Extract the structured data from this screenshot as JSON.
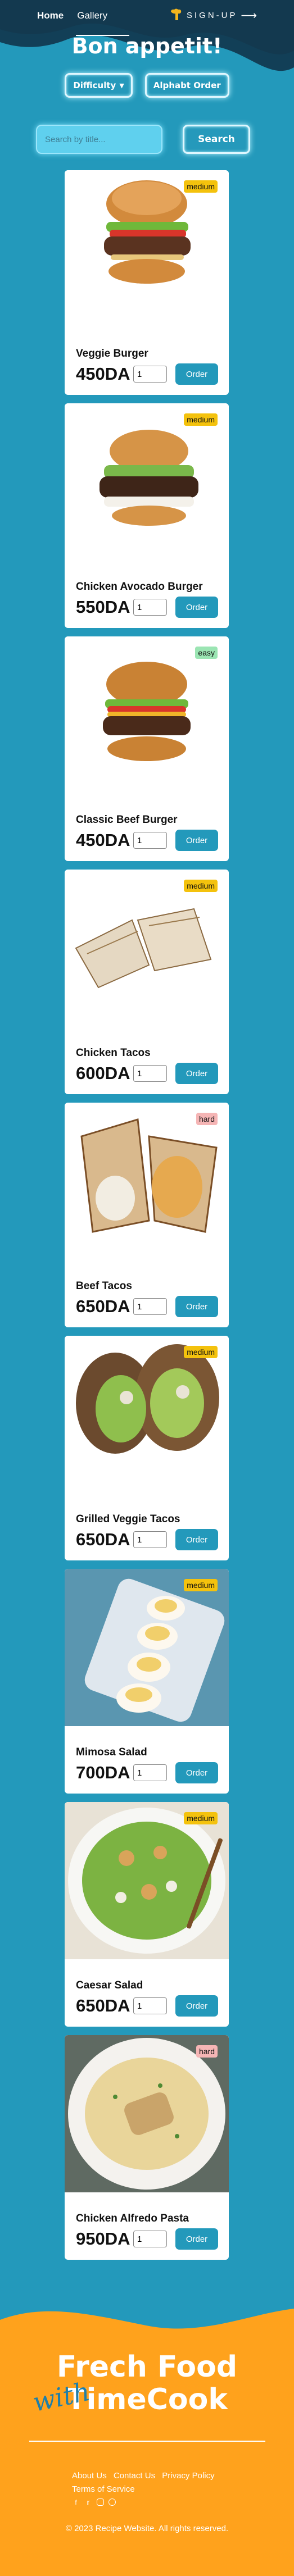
{
  "nav": {
    "home": "Home",
    "gallery": "Gallery"
  },
  "signup": {
    "label": "SIGN-UP",
    "arrow": "⟶"
  },
  "page": {
    "title": "Bon appetit!"
  },
  "controls": {
    "difficulty_label": "Difficulty",
    "sort_label": "Alphabt Order"
  },
  "search": {
    "placeholder": "Search by title...",
    "button_label": "Search"
  },
  "recipes": [
    {
      "name": "Veggie Burger",
      "price": "450DA",
      "difficulty": "medium",
      "qty": "1",
      "order_label": "Order",
      "image": "veggie-burger"
    },
    {
      "name": "Chicken Avocado Burger",
      "price": "550DA",
      "difficulty": "medium",
      "qty": "1",
      "order_label": "Order",
      "image": "chicken-avocado-burger"
    },
    {
      "name": "Classic Beef Burger",
      "price": "450DA",
      "difficulty": "easy",
      "qty": "1",
      "order_label": "Order",
      "image": "classic-beef-burger"
    },
    {
      "name": "Chicken Tacos",
      "price": "600DA",
      "difficulty": "medium",
      "qty": "1",
      "order_label": "Order",
      "image": "chicken-tacos"
    },
    {
      "name": "Beef Tacos",
      "price": "650DA",
      "difficulty": "hard",
      "qty": "1",
      "order_label": "Order",
      "image": "beef-tacos"
    },
    {
      "name": "Grilled Veggie Tacos",
      "price": "650DA",
      "difficulty": "medium",
      "qty": "1",
      "order_label": "Order",
      "image": "grilled-veggie-tacos"
    },
    {
      "name": "Mimosa Salad",
      "price": "700DA",
      "difficulty": "medium",
      "qty": "1",
      "order_label": "Order",
      "image": "mimosa-salad"
    },
    {
      "name": "Caesar Salad",
      "price": "650DA",
      "difficulty": "medium",
      "qty": "1",
      "order_label": "Order",
      "image": "caesar-salad"
    },
    {
      "name": "Chicken Alfredo Pasta",
      "price": "950DA",
      "difficulty": "hard",
      "qty": "1",
      "order_label": "Order",
      "image": "chicken-alfredo-pasta"
    }
  ],
  "footer": {
    "brand_line1": "Frech Food",
    "brand_with": "with",
    "brand_line2": "TimeCook",
    "links": [
      "About Us",
      "Contact Us",
      "Privacy Policy",
      "Terms of Service"
    ],
    "social_icons": [
      "facebook-icon",
      "twitter-icon",
      "instagram-icon",
      "pinterest-icon"
    ],
    "copyright": "© 2023 Recipe Website. All rights reserved."
  },
  "colors": {
    "background": "#2399bb",
    "header_wave": "#0f2f45",
    "footer_orange": "#ffa21c",
    "medium": "#f4c20d",
    "easy": "#9be5b3",
    "hard": "#f5b5b5"
  }
}
